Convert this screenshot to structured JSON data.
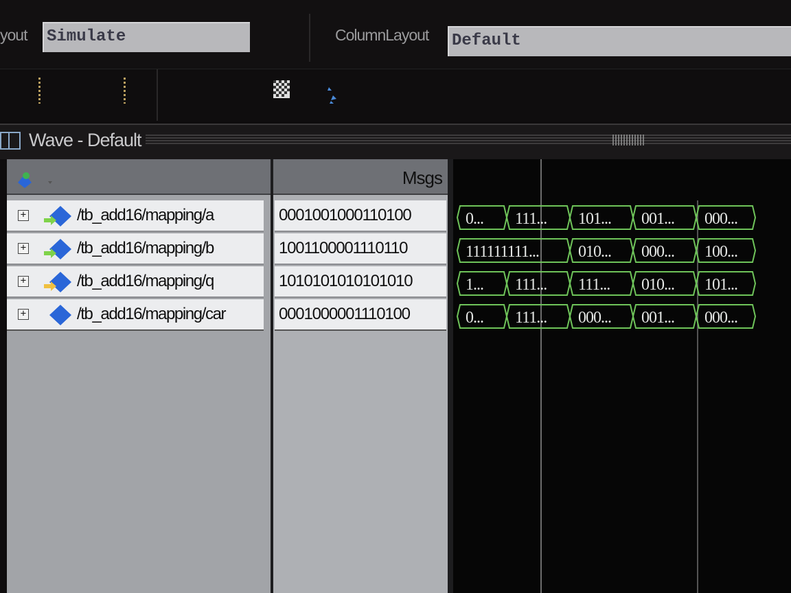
{
  "toolbar": {
    "layout_label": "yout",
    "layout_value": "Simulate",
    "column_layout_label": "ColumnLayout",
    "column_layout_value": "Default"
  },
  "wave_window": {
    "title": "Wave - Default",
    "values_header": "Msgs"
  },
  "signals": [
    {
      "name": "/tb_add16/mapping/a",
      "value": "0001001000110100",
      "wave": [
        "0...",
        "111...",
        "101...",
        "001...",
        "000..."
      ]
    },
    {
      "name": "/tb_add16/mapping/b",
      "value": "1001100001110110",
      "wave": [
        "111111111...",
        "010...",
        "000...",
        "100..."
      ]
    },
    {
      "name": "/tb_add16/mapping/q",
      "value": "1010101010101010",
      "wave": [
        "1...",
        "111...",
        "111...",
        "010...",
        "101..."
      ]
    },
    {
      "name": "/tb_add16/mapping/car",
      "value": "0001000001110100",
      "wave": [
        "0...",
        "111...",
        "000...",
        "001...",
        "000..."
      ]
    }
  ],
  "colors": {
    "wave_trace": "#6fc45a",
    "cursor": "#a0a0a0",
    "signal_icon_blue": "#2a66d8",
    "signal_icon_arrow": "#7fd24a"
  },
  "icons": [
    "expand-plus-icon",
    "signal-diamond-icon",
    "wave-tool-icon",
    "window-icon"
  ]
}
